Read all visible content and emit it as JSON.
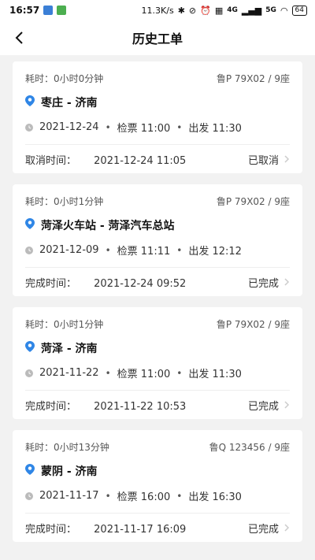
{
  "status_bar": {
    "time": "16:57",
    "speed": "11.3K/s",
    "battery": "64",
    "signal_a": "4G",
    "signal_b": "5G"
  },
  "nav": {
    "title": "历史工单"
  },
  "orders": [
    {
      "duration": "耗时：0小时0分钟",
      "vehicle": "鲁P 79X02 / 9座",
      "route": "枣庄 - 济南",
      "date": "2021-12-24",
      "check_in": "检票 11:00",
      "depart": "出发 11:30",
      "result_label": "取消时间：",
      "result_time": "2021-12-24 11:05",
      "status": "已取消"
    },
    {
      "duration": "耗时：0小时1分钟",
      "vehicle": "鲁P 79X02 / 9座",
      "route": "菏泽火车站 - 菏泽汽车总站",
      "date": "2021-12-09",
      "check_in": "检票 11:11",
      "depart": "出发 12:12",
      "result_label": "完成时间：",
      "result_time": "2021-12-24 09:52",
      "status": "已完成"
    },
    {
      "duration": "耗时：0小时1分钟",
      "vehicle": "鲁P 79X02 / 9座",
      "route": "菏泽 - 济南",
      "date": "2021-11-22",
      "check_in": "检票 11:00",
      "depart": "出发 11:30",
      "result_label": "完成时间：",
      "result_time": "2021-11-22 10:53",
      "status": "已完成"
    },
    {
      "duration": "耗时：0小时13分钟",
      "vehicle": "鲁Q 123456 / 9座",
      "route": "蒙阴 - 济南",
      "date": "2021-11-17",
      "check_in": "检票 16:00",
      "depart": "出发 16:30",
      "result_label": "完成时间：",
      "result_time": "2021-11-17 16:09",
      "status": "已完成"
    }
  ],
  "colors": {
    "background": "#f2f2f2",
    "card": "#ffffff",
    "location_pin": "#2f86e6",
    "muted_icon": "#bbbbbb"
  }
}
